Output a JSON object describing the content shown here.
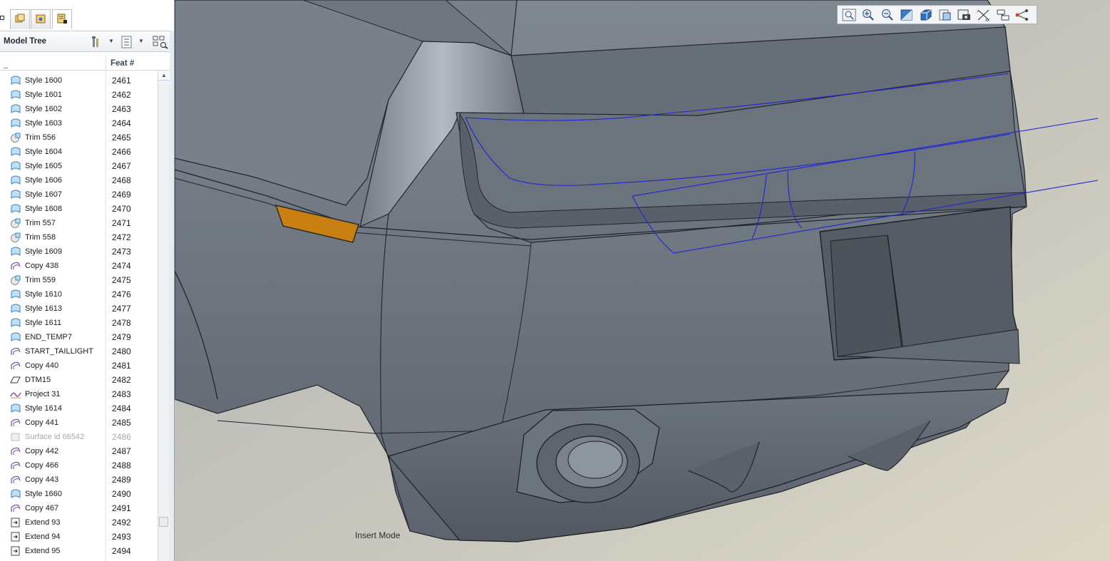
{
  "left_panel": {
    "top_tabs": [
      {
        "icon": "folder-browser-icon"
      },
      {
        "icon": "layers-icon"
      },
      {
        "icon": "favorites-icon"
      },
      {
        "icon": "model-tree-tab-icon"
      }
    ],
    "tree_title": "Model Tree",
    "toolbar_icons": [
      "tree-settings-icon",
      "tree-filters-icon",
      "tree-columns-icon"
    ],
    "column_header": "Feat #",
    "rows": [
      {
        "name": "Style 1600",
        "feat": "2461",
        "icon": "style-icon"
      },
      {
        "name": "Style 1601",
        "feat": "2462",
        "icon": "style-icon"
      },
      {
        "name": "Style 1602",
        "feat": "2463",
        "icon": "style-icon"
      },
      {
        "name": "Style 1603",
        "feat": "2464",
        "icon": "style-icon"
      },
      {
        "name": "Trim 556",
        "feat": "2465",
        "icon": "trim-icon"
      },
      {
        "name": "Style 1604",
        "feat": "2466",
        "icon": "style-icon"
      },
      {
        "name": "Style 1605",
        "feat": "2467",
        "icon": "style-icon"
      },
      {
        "name": "Style 1606",
        "feat": "2468",
        "icon": "style-icon"
      },
      {
        "name": "Style 1607",
        "feat": "2469",
        "icon": "style-icon"
      },
      {
        "name": "Style 1608",
        "feat": "2470",
        "icon": "style-icon"
      },
      {
        "name": "Trim 557",
        "feat": "2471",
        "icon": "trim-icon"
      },
      {
        "name": "Trim 558",
        "feat": "2472",
        "icon": "trim-icon"
      },
      {
        "name": "Style 1609",
        "feat": "2473",
        "icon": "style-icon"
      },
      {
        "name": "Copy 438",
        "feat": "2474",
        "icon": "copy-icon"
      },
      {
        "name": "Trim 559",
        "feat": "2475",
        "icon": "trim-icon"
      },
      {
        "name": "Style 1610",
        "feat": "2476",
        "icon": "style-icon"
      },
      {
        "name": "Style 1613",
        "feat": "2477",
        "icon": "style-icon"
      },
      {
        "name": "Style 1611",
        "feat": "2478",
        "icon": "style-icon"
      },
      {
        "name": "END_TEMP7",
        "feat": "2479",
        "icon": "style-icon"
      },
      {
        "name": "START_TAILLIGHT",
        "feat": "2480",
        "icon": "copy-icon"
      },
      {
        "name": "Copy 440",
        "feat": "2481",
        "icon": "copy-icon"
      },
      {
        "name": "DTM15",
        "feat": "2482",
        "icon": "datum-plane-icon"
      },
      {
        "name": "Project 31",
        "feat": "2483",
        "icon": "project-curve-icon"
      },
      {
        "name": "Style 1614",
        "feat": "2484",
        "icon": "style-icon"
      },
      {
        "name": "Copy 441",
        "feat": "2485",
        "icon": "copy-icon"
      },
      {
        "name": "Surface id 66542",
        "feat": "2486",
        "icon": "surface-icon",
        "suppressed": true
      },
      {
        "name": "Copy 442",
        "feat": "2487",
        "icon": "copy-icon"
      },
      {
        "name": "Copy 466",
        "feat": "2488",
        "icon": "copy-icon"
      },
      {
        "name": "Copy 443",
        "feat": "2489",
        "icon": "copy-icon"
      },
      {
        "name": "Style 1660",
        "feat": "2490",
        "icon": "style-icon"
      },
      {
        "name": "Copy 467",
        "feat": "2491",
        "icon": "copy-icon"
      },
      {
        "name": "Extend 93",
        "feat": "2492",
        "icon": "extend-icon"
      },
      {
        "name": "Extend 94",
        "feat": "2493",
        "icon": "extend-icon"
      },
      {
        "name": "Extend 95",
        "feat": "2494",
        "icon": "extend-icon"
      }
    ]
  },
  "view_toolbar": {
    "icons": [
      "refit-icon",
      "zoom-in-icon",
      "zoom-out-icon",
      "repaint-icon",
      "display-style-icon",
      "saved-views-icon",
      "view-manager-icon",
      "datum-display-icon",
      "annotation-display-icon",
      "spin-center-icon"
    ]
  },
  "viewport": {
    "mode_label": "Insert Mode",
    "colors": {
      "background_top": "#b7b9b9",
      "background_bottom": "#d6d4c7",
      "body_surface": "#6a727c",
      "edge_line": "#20262c",
      "curve_blue": "#1f24d8",
      "reflector_amber": "#c97f12"
    }
  }
}
